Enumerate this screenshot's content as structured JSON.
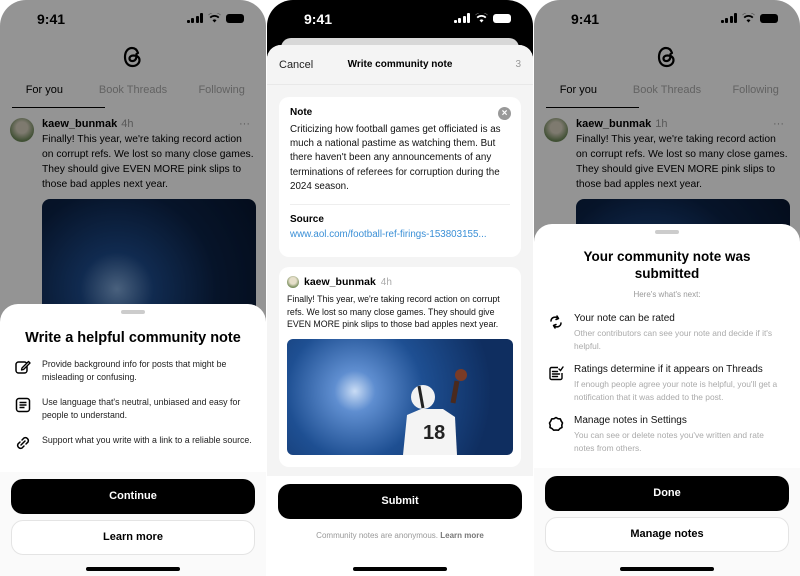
{
  "status_time": "9:41",
  "feed": {
    "tabs": [
      "For you",
      "Book Threads",
      "Following"
    ],
    "post": {
      "username": "kaew_bunmak",
      "time_left": "4h",
      "time_right": "1h",
      "more": "···",
      "text": "Finally! This year, we're taking record action on corrupt refs. We lost so many close games. They should give EVEN MORE pink slips to those bad apples next year."
    }
  },
  "intro_sheet": {
    "title": "Write a helpful community note",
    "tips": [
      {
        "icon": "edit-icon",
        "text": "Provide background info for posts that might be misleading or confusing."
      },
      {
        "icon": "document-icon",
        "text": "Use language that's neutral, unbiased and easy for people to understand."
      },
      {
        "icon": "link-icon",
        "text": "Support what you write with a link to a reliable source."
      }
    ],
    "continue_label": "Continue",
    "learn_more_label": "Learn more"
  },
  "compose": {
    "cancel_label": "Cancel",
    "title": "Write community note",
    "step_count": "3",
    "note_label": "Note",
    "note_text": "Criticizing how football games get officiated is as much a national pastime as watching them. But there haven't been any announcements of any terminations of referees for corruption during the 2024 season.",
    "source_label": "Source",
    "source_url": "www.aol.com/football-ref-firings-153803155...",
    "post": {
      "username": "kaew_bunmak",
      "time": "4h",
      "text": "Finally! This year, we're taking record action on corrupt refs. We lost so many close games. They should give EVEN MORE pink slips to those bad apples next year."
    },
    "submit_label": "Submit",
    "anon_text": "Community notes are anonymous.",
    "anon_link": "Learn more"
  },
  "submitted_sheet": {
    "title": "Your community note was submitted",
    "subtitle": "Here's what's next:",
    "steps": [
      {
        "icon": "rate-icon",
        "title": "Your note can be rated",
        "desc": "Other contributors can see your note and decide if it's helpful."
      },
      {
        "icon": "checklist-icon",
        "title": "Ratings determine if it appears on Threads",
        "desc": "If enough people agree your note is helpful, you'll get a notification that it was added to the post."
      },
      {
        "icon": "settings-icon",
        "title": "Manage notes in Settings",
        "desc": "You can see or delete notes you've written and rate notes from others."
      }
    ],
    "done_label": "Done",
    "manage_label": "Manage notes"
  }
}
